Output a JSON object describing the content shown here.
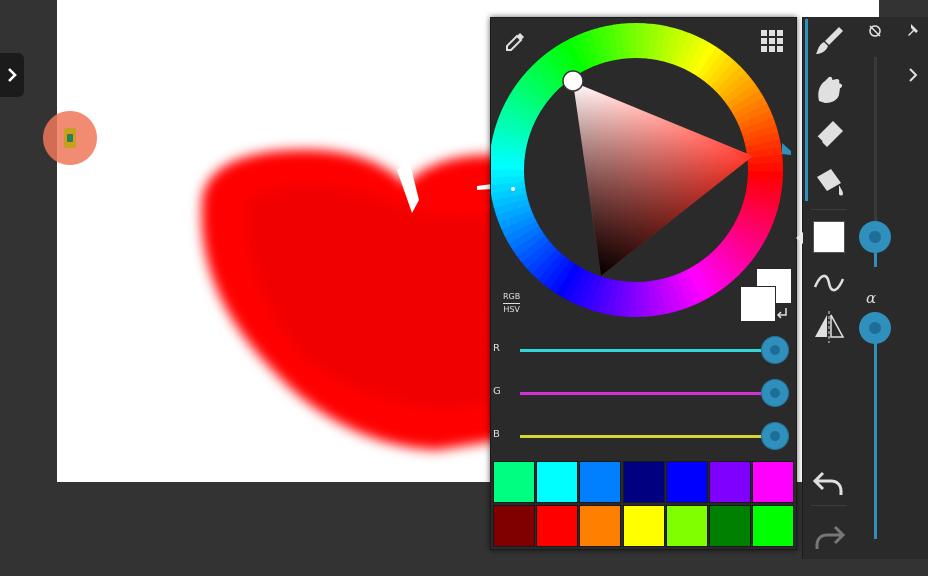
{
  "sidebar_toggle": {
    "icon": "chevron-right-icon"
  },
  "floating_bubble": {
    "icon": "app-shortcut-icon",
    "color": "#ee785a"
  },
  "canvas": {
    "background": "#ffffff",
    "stroke_color": "#ff0000"
  },
  "color_panel": {
    "eyedropper_icon": "eyedropper-icon",
    "grid_icon": "grid-icon",
    "mode_toggle": {
      "top": "RGB",
      "bottom": "HSV"
    },
    "current_color": "#ffffff",
    "previous_color": "#ffffff",
    "sliders": [
      {
        "label": "R",
        "value": 255,
        "max": 255,
        "color": "#33d6d6"
      },
      {
        "label": "G",
        "value": 255,
        "max": 255,
        "color": "#d633d6"
      },
      {
        "label": "B",
        "value": 255,
        "max": 255,
        "color": "#d6d633"
      }
    ],
    "palette_row1": [
      "#00ff80",
      "#00ffff",
      "#0080ff",
      "#000080",
      "#0000ff",
      "#8000ff",
      "#ff00ff"
    ],
    "palette_row2": [
      "#800000",
      "#ff0000",
      "#ff8000",
      "#ffff00",
      "#80ff00",
      "#008000",
      "#00ff00"
    ],
    "wheel_hue_marker": 120
  },
  "tool_panel": {
    "tools": [
      "brush-icon",
      "smudge-hand-icon",
      "eraser-icon",
      "fill-bucket-icon"
    ],
    "stroke_icon": "stroke-curve-icon",
    "symmetry_icon": "symmetry-icon",
    "undo_icon": "undo-icon",
    "redo_icon": "redo-icon",
    "size_slider_value": 0.0,
    "alpha_label": "α",
    "alpha_slider_value": 1.0
  }
}
